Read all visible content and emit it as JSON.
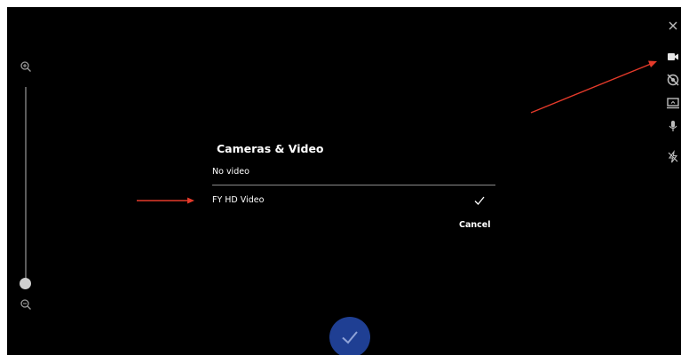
{
  "dialog": {
    "title": "Cameras & Video",
    "options": [
      {
        "label": "No video",
        "selected": false
      },
      {
        "label": "FY HD Video",
        "selected": true
      }
    ],
    "cancel_label": "Cancel"
  },
  "zoom": {
    "in_icon": "zoom-in-icon",
    "out_icon": "zoom-out-icon",
    "level": 0
  },
  "toolbar": {
    "icons": [
      "close-icon",
      "video-camera-icon",
      "camera-off-icon",
      "screen-share-icon",
      "microphone-icon",
      "flash-off-icon"
    ]
  },
  "confirm": {
    "icon": "checkmark-icon"
  },
  "colors": {
    "background": "#000000",
    "accent": "#1f3f93",
    "annotation_arrow": "#e53a2a",
    "text": "#ffffff"
  }
}
